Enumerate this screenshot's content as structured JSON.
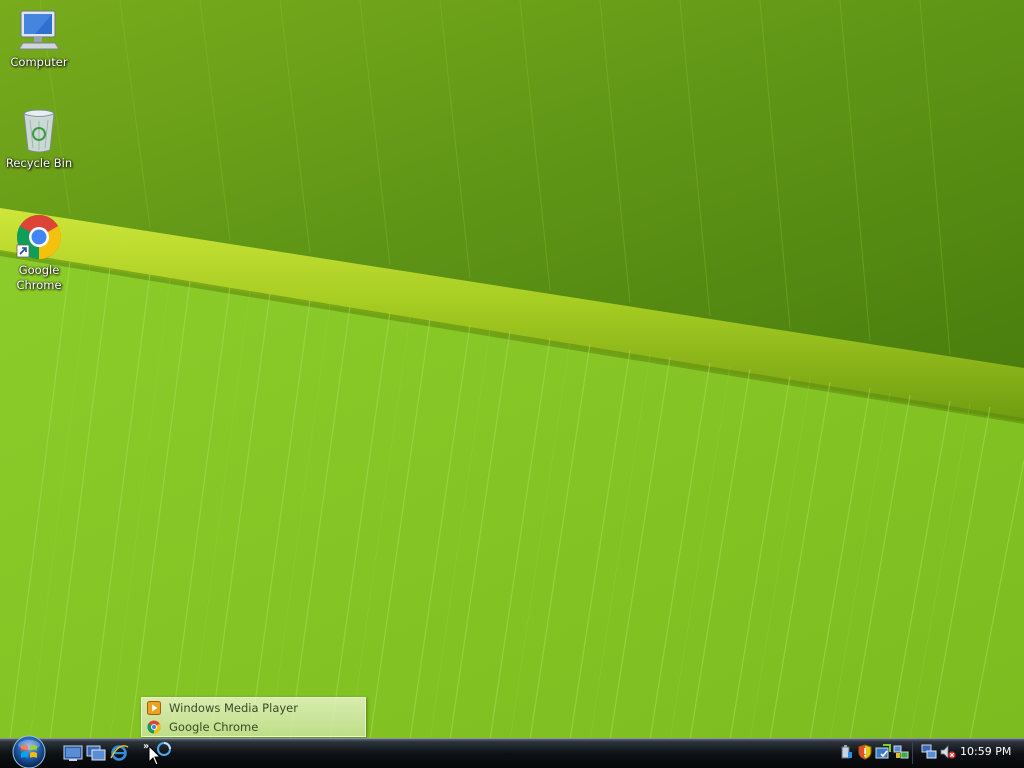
{
  "desktop": {
    "icons": [
      {
        "label": "Computer",
        "icon": "computer-icon"
      },
      {
        "label": "Recycle Bin",
        "icon": "recycle-bin-icon"
      },
      {
        "label": "Google Chrome",
        "icon": "chrome-icon"
      }
    ]
  },
  "taskbar": {
    "start_button": "windows-start-orb",
    "quick_launch": [
      "show-desktop-icon",
      "switch-windows-icon",
      "internet-explorer-icon"
    ],
    "overflow_chevron": "»",
    "overflow_menu": [
      {
        "label": "Windows Media Player",
        "icon": "media-player-icon"
      },
      {
        "label": "Google Chrome",
        "icon": "chrome-icon"
      }
    ],
    "tray": {
      "icons": [
        "safely-remove-icon",
        "security-shield-icon",
        "windows-update-icon",
        "network-icon",
        "volume-muted-icon"
      ],
      "clock": "10:59 PM"
    }
  },
  "colors": {
    "leaf_green": "#86c926",
    "midrib": "#b6d82a",
    "taskbar": "#0e1216"
  }
}
